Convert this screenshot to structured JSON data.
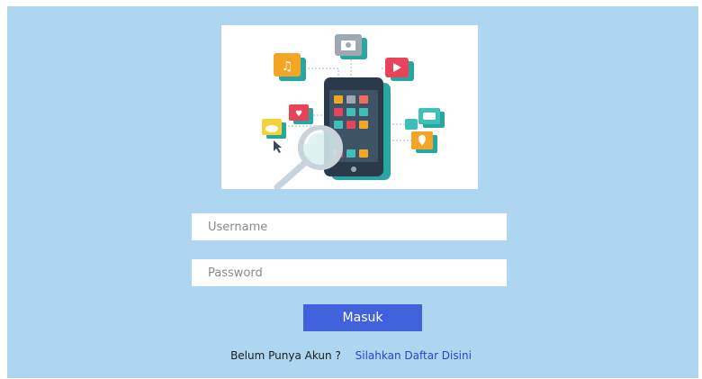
{
  "login": {
    "username_placeholder": "Username",
    "password_placeholder": "Password",
    "submit_label": "Masuk",
    "register_question": "Belum Punya Akun ?",
    "register_link": "Silahkan Daftar Disini"
  },
  "colors": {
    "background": "#aed6f1",
    "button": "#4062dc",
    "link": "#2746c9"
  },
  "illustration": {
    "icons": [
      "music-icon",
      "camera-icon",
      "video-icon",
      "heart-icon",
      "cloud-icon",
      "chat-icon",
      "location-icon",
      "cursor-icon",
      "magnifier-icon",
      "smartphone-icon"
    ]
  }
}
